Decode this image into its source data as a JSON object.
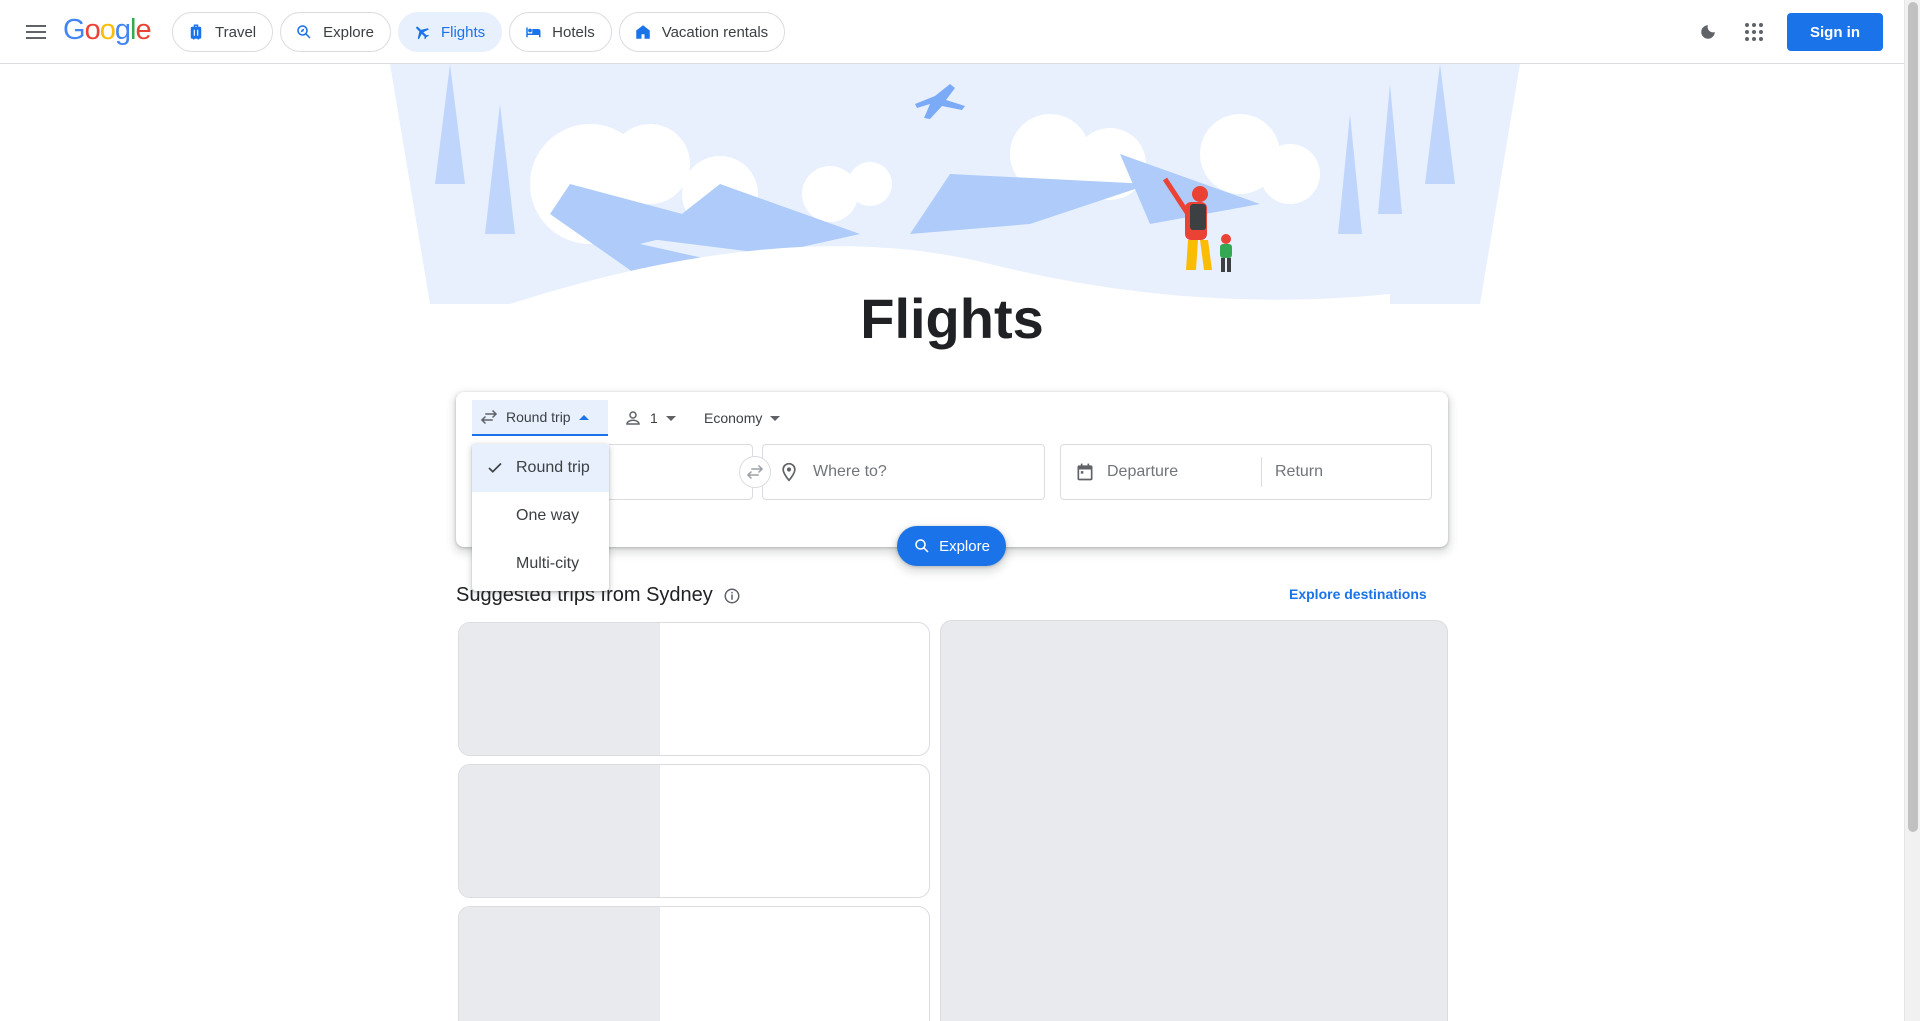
{
  "header": {
    "logo": "Google",
    "nav": [
      {
        "label": "Travel",
        "icon": "luggage-icon",
        "active": false
      },
      {
        "label": "Explore",
        "icon": "explore-icon",
        "active": false
      },
      {
        "label": "Flights",
        "icon": "flight-icon",
        "active": true
      },
      {
        "label": "Hotels",
        "icon": "hotel-icon",
        "active": false
      },
      {
        "label": "Vacation rentals",
        "icon": "house-icon",
        "active": false
      }
    ],
    "signin_label": "Sign in"
  },
  "hero": {
    "title": "Flights"
  },
  "search": {
    "trip_type": "Round trip",
    "passengers": "1",
    "cabin_class": "Economy",
    "from_value": "",
    "to_placeholder": "Where to?",
    "departure_placeholder": "Departure",
    "return_placeholder": "Return",
    "explore_label": "Explore"
  },
  "trip_dropdown": {
    "options": [
      "Round trip",
      "One way",
      "Multi-city"
    ],
    "selected": "Round trip"
  },
  "suggestions": {
    "title": "Suggested trips from Sydney",
    "explore_link": "Explore destinations"
  },
  "colors": {
    "accent": "#1a73e8",
    "active_chip_bg": "#e8f0fe",
    "skeleton": "#e8eaed"
  }
}
